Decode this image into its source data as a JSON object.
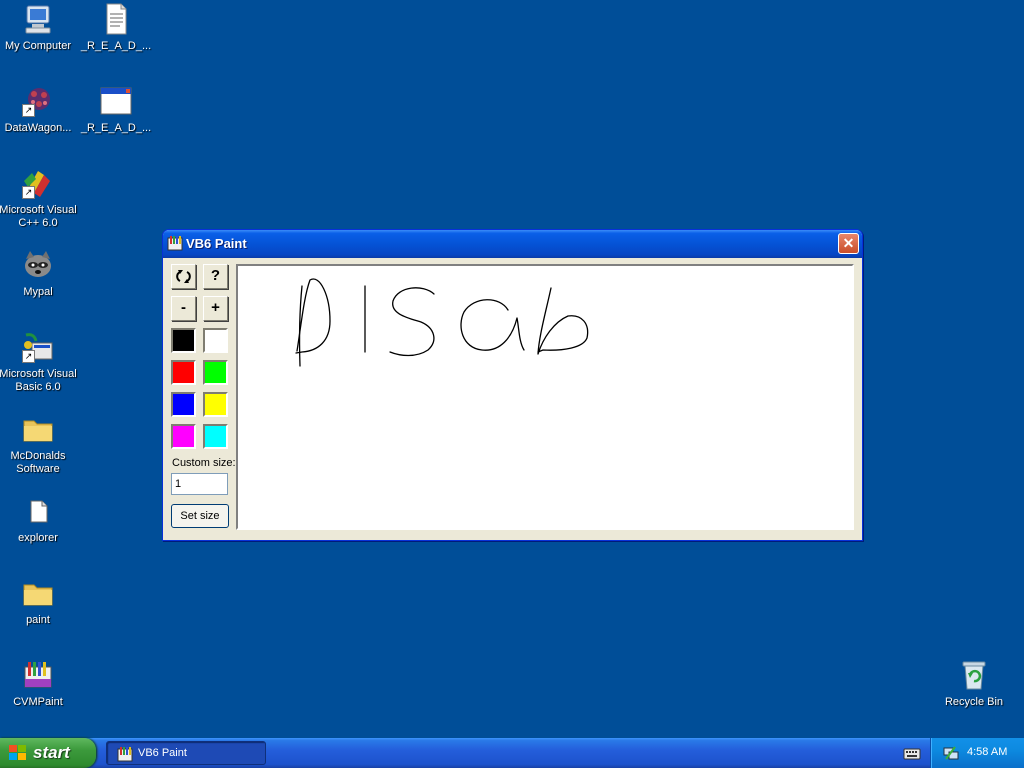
{
  "desktop": {
    "icons": [
      {
        "label": "My Computer",
        "icon": "my-computer-icon"
      },
      {
        "label": "_R_E_A_D_...",
        "icon": "text-document-icon"
      },
      {
        "label": "DataWagon...",
        "icon": "datawagon-icon"
      },
      {
        "label": "_R_E_A_D_...",
        "icon": "window-application-icon"
      },
      {
        "label": "Microsoft Visual C++ 6.0",
        "icon": "visual-cpp-icon"
      },
      {
        "label": "Mypal",
        "icon": "mypal-raccoon-icon"
      },
      {
        "label": "Microsoft Visual Basic 6.0",
        "icon": "visual-basic-icon"
      },
      {
        "label": "McDonalds Software",
        "icon": "folder-icon"
      },
      {
        "label": "explorer",
        "icon": "explorer-icon"
      },
      {
        "label": "paint",
        "icon": "folder-icon"
      },
      {
        "label": "CVMPaint",
        "icon": "cvmpaint-icon"
      },
      {
        "label": "Recycle Bin",
        "icon": "recycle-bin-icon"
      }
    ]
  },
  "window": {
    "title": "VB6 Paint",
    "title_icon": "vb6-paint-app-icon",
    "close_icon": "close-icon",
    "tools": {
      "refresh_icon": "refresh-icon",
      "help_label": "?",
      "minus_label": "-",
      "plus_label": "+"
    },
    "palette": [
      {
        "name": "black",
        "color": "#000000"
      },
      {
        "name": "white",
        "color": "#ffffff"
      },
      {
        "name": "red",
        "color": "#ff0000"
      },
      {
        "name": "green",
        "color": "#00ff00"
      },
      {
        "name": "blue",
        "color": "#0000ff"
      },
      {
        "name": "yellow",
        "color": "#ffff00"
      },
      {
        "name": "magenta",
        "color": "#ff00ff"
      },
      {
        "name": "cyan",
        "color": "#00ffff"
      }
    ],
    "custom_size_label": "Custom size:",
    "custom_size_value": "1",
    "set_size_label": "Set size"
  },
  "taskbar": {
    "start_label": "start",
    "task_label": "VB6 Paint",
    "clock": "4:58 AM"
  }
}
